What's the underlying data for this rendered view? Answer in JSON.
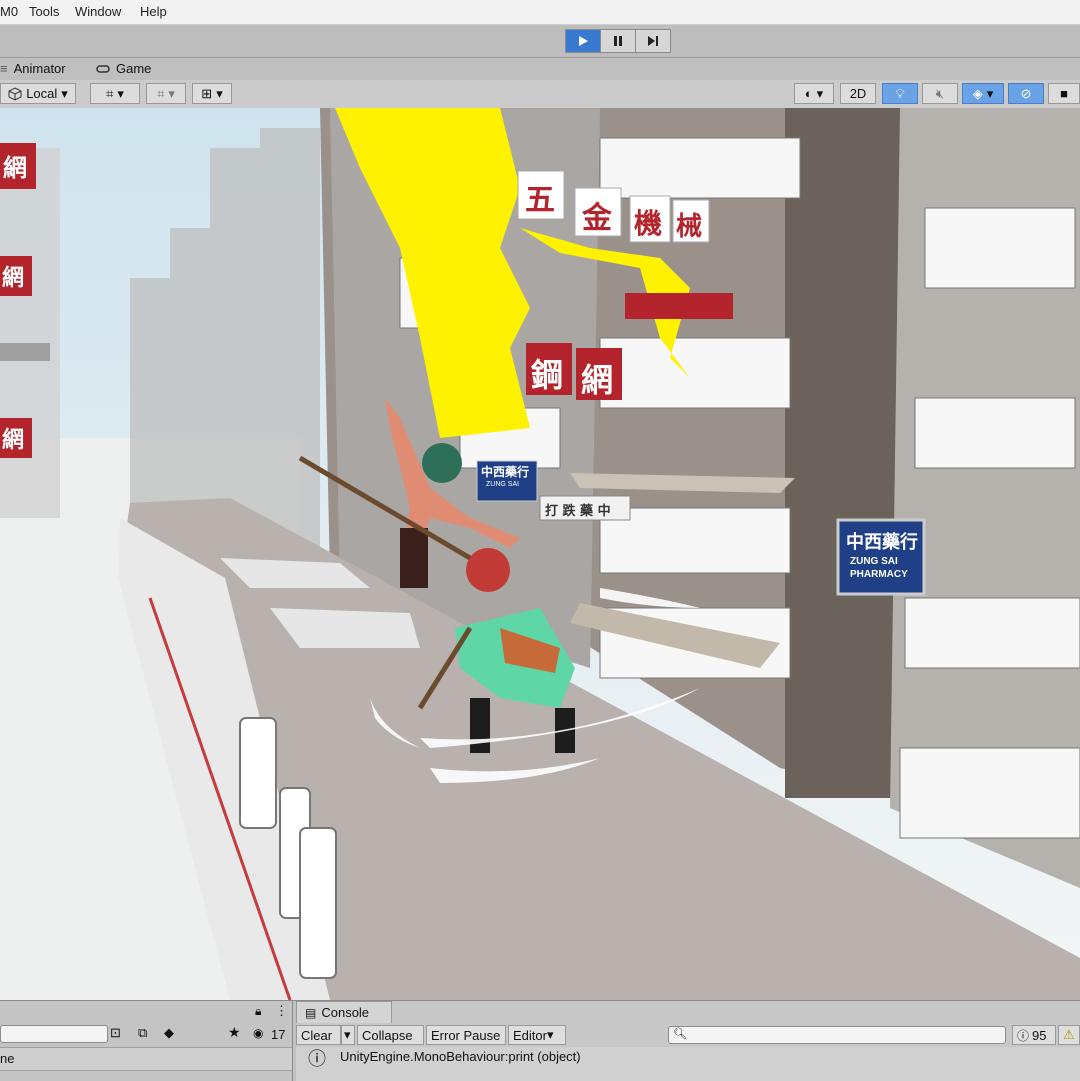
{
  "menu": {
    "items": [
      "M0",
      "Tools",
      "Window",
      "Help"
    ]
  },
  "playbar": {
    "play_icon": "play-icon",
    "pause_icon": "pause-icon",
    "step_icon": "step-icon"
  },
  "tabs": [
    {
      "label": "Animator",
      "icon": ""
    },
    {
      "label": "Game",
      "icon": "gamepad-icon"
    }
  ],
  "toolbar": {
    "pivot_label": "Local",
    "mode_2d_label": "2D"
  },
  "scene": {
    "signs": {
      "wu": "五",
      "jin": "金",
      "ji": "機",
      "xie": "械",
      "gang": "鋼",
      "wang": "網",
      "pharmacy_cn": "中西藥行",
      "pharmacy_en_1": "ZUNG SAI",
      "pharmacy_en_2": "PHARMACY",
      "dajie": "打 跌 藥 中",
      "left_sign_1": "網",
      "left_sign_2": "網",
      "left_sign_3": "網"
    }
  },
  "hierarchy": {
    "count": "17",
    "row_label": "ne"
  },
  "console": {
    "tab_label": "Console",
    "clear_label": "Clear",
    "collapse_label": "Collapse",
    "error_pause_label": "Error Pause",
    "editor_label": "Editor",
    "warning_count": "95",
    "log_line_1": "UnityEngine.MonoBehaviour:print (object)"
  },
  "colors": {
    "accent_blue": "#3a79d0",
    "lightning": "#fff200",
    "sign_red": "#b3242c",
    "sign_blue": "#1f3f86"
  }
}
